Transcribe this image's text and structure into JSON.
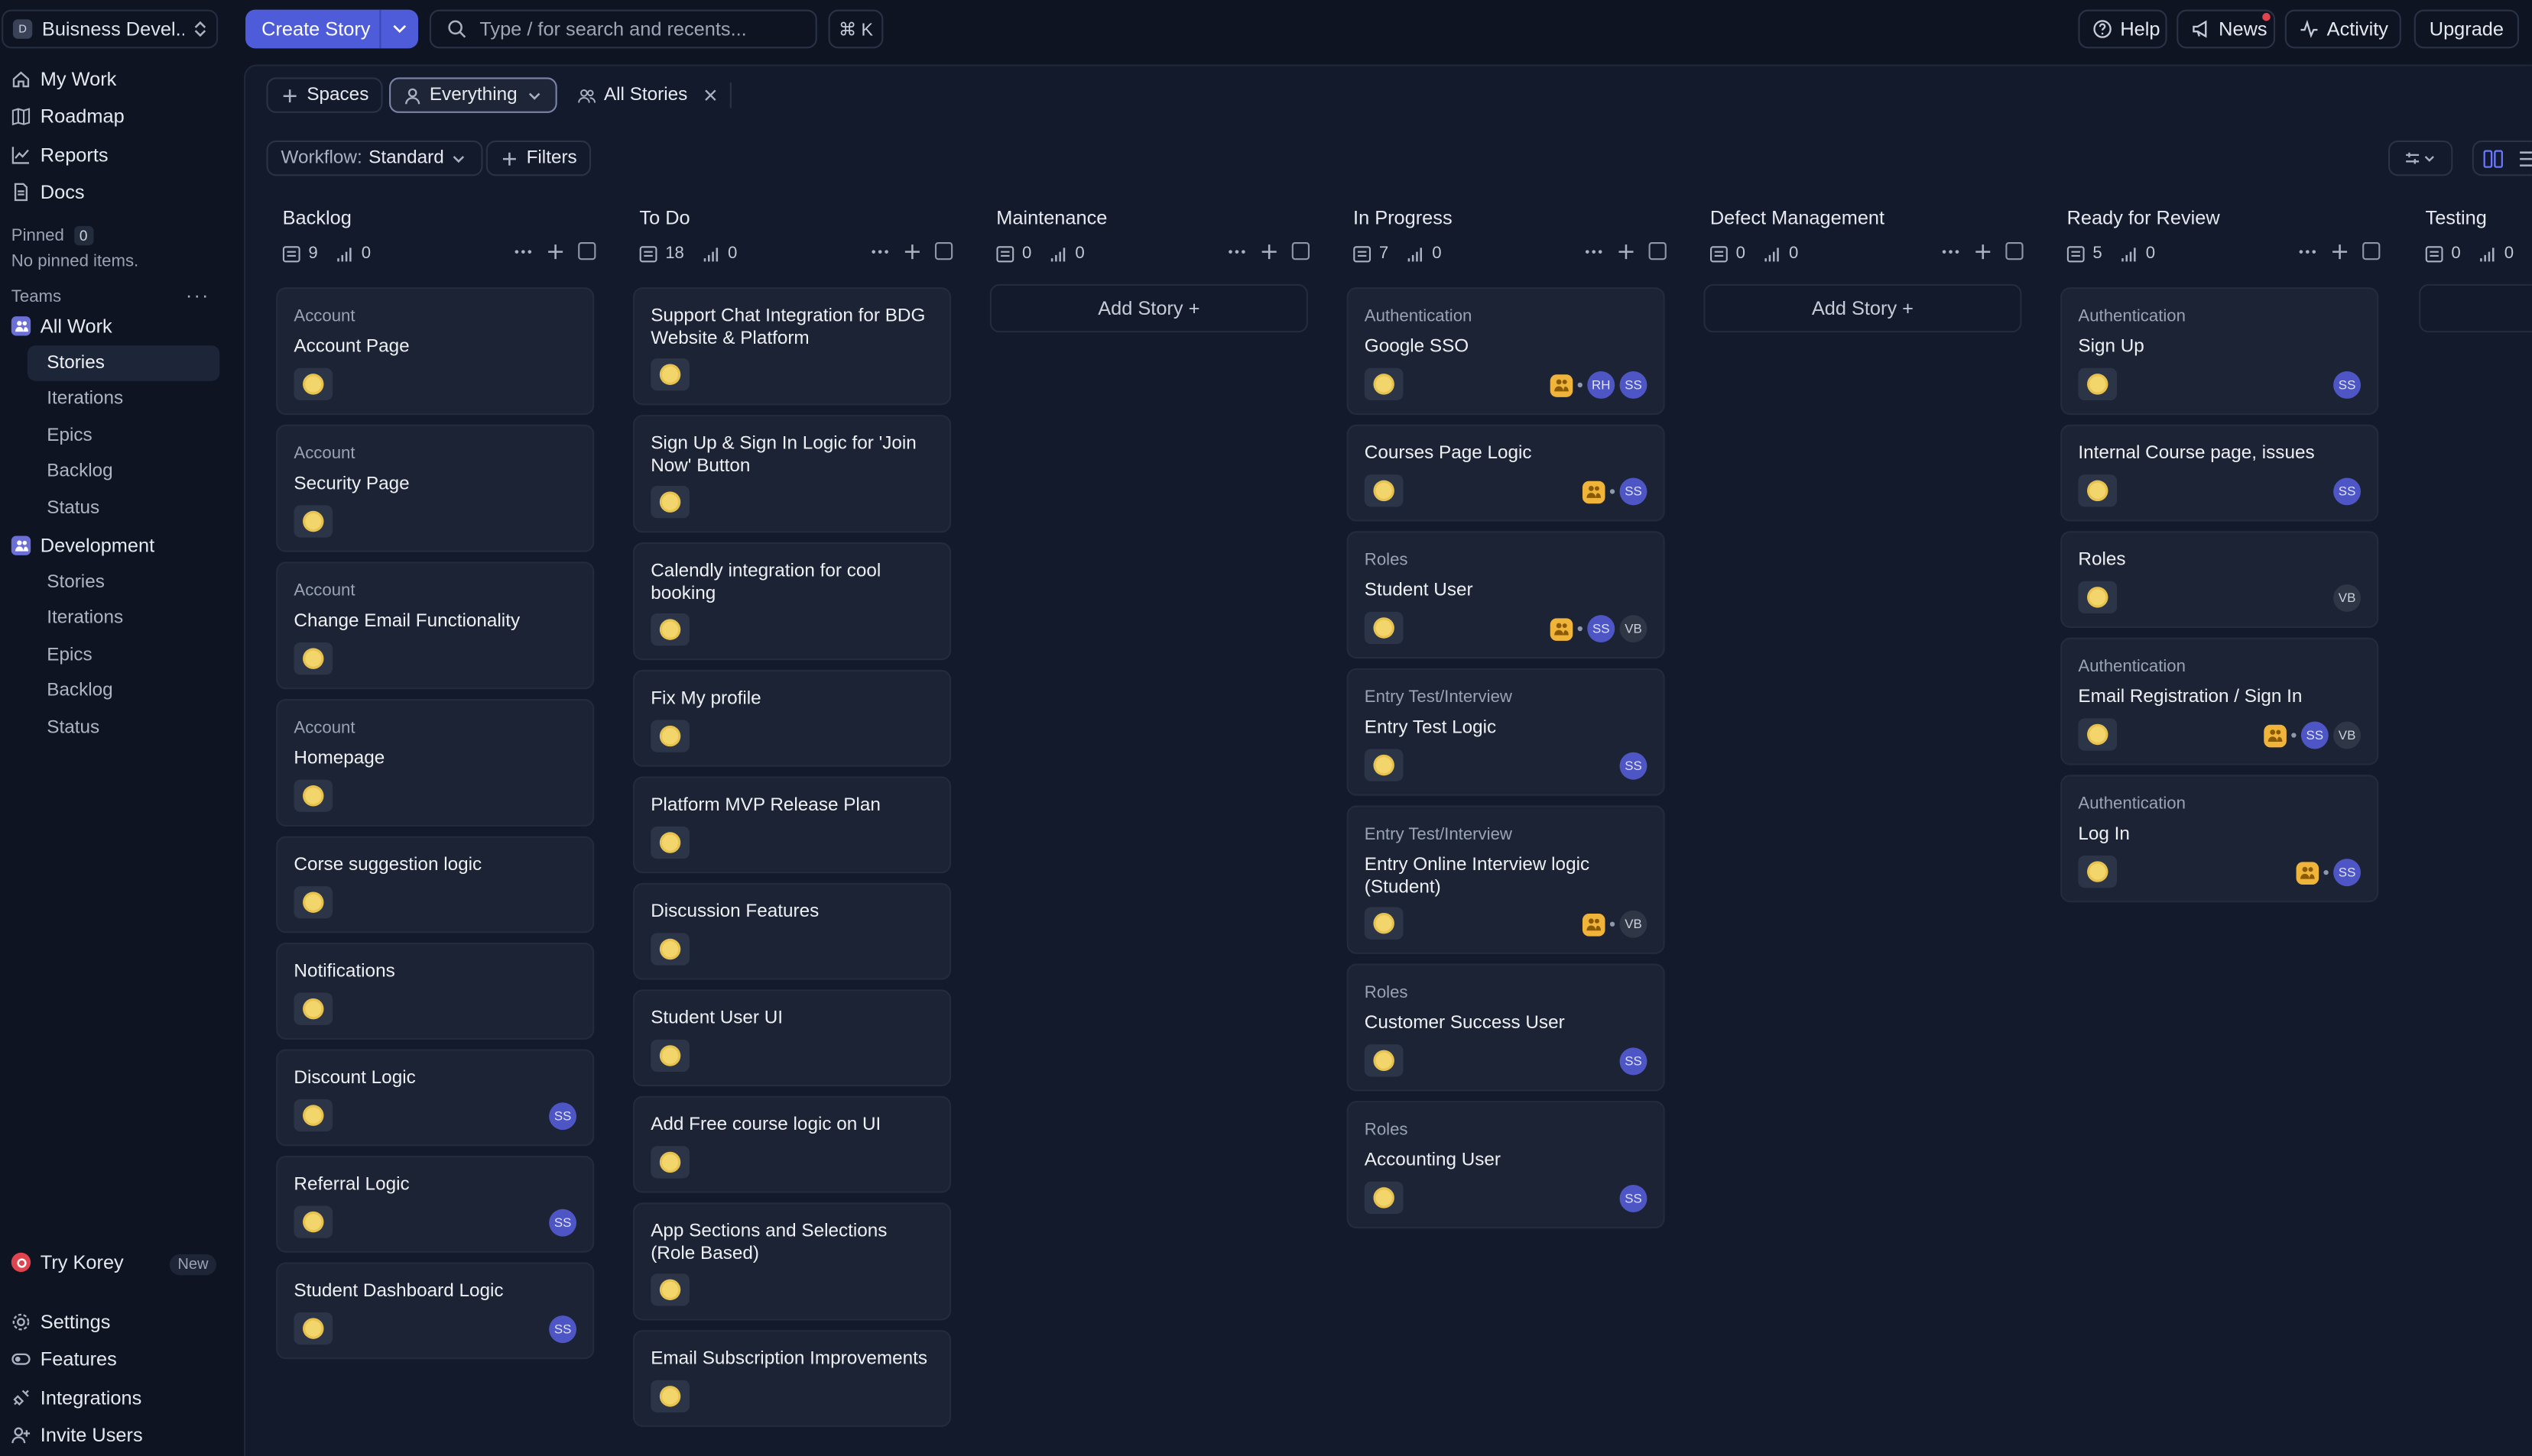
{
  "workspace": {
    "logo_letter": "D",
    "name": "Buisness Devel..."
  },
  "sidebar": {
    "nav": [
      {
        "label": "My Work",
        "icon": "home-icon"
      },
      {
        "label": "Roadmap",
        "icon": "map-icon"
      },
      {
        "label": "Reports",
        "icon": "chart-line-icon"
      },
      {
        "label": "Docs",
        "icon": "doc-icon"
      }
    ],
    "pinned": {
      "label": "Pinned",
      "count": "0",
      "empty_text": "No pinned items."
    },
    "teams_label": "Teams",
    "teams_more": "···",
    "teams": [
      {
        "label": "All Work",
        "items": [
          "Stories",
          "Iterations",
          "Epics",
          "Backlog",
          "Status"
        ],
        "active": "Stories"
      },
      {
        "label": "Development",
        "items": [
          "Stories",
          "Iterations",
          "Epics",
          "Backlog",
          "Status"
        ]
      }
    ],
    "try_korey": {
      "label": "Try Korey",
      "badge": "New"
    },
    "bottom": [
      {
        "label": "Settings",
        "icon": "gear-icon"
      },
      {
        "label": "Features",
        "icon": "toggle-icon"
      },
      {
        "label": "Integrations",
        "icon": "plug-icon"
      },
      {
        "label": "Invite Users",
        "icon": "user-plus-icon"
      }
    ]
  },
  "topbar": {
    "create_label": "Create Story",
    "search_placeholder": "Type / for search and recents...",
    "shortcut": "⌘ K",
    "help": "Help",
    "news": "News",
    "activity": "Activity",
    "upgrade": "Upgrade"
  },
  "filters": {
    "spaces": "Spaces",
    "everything": "Everything",
    "all_stories": "All Stories",
    "workflow_label": "Workflow:",
    "workflow_value": "Standard",
    "filters_label": "Filters"
  },
  "board": {
    "add_story": "Add Story +",
    "columns": [
      {
        "title": "Backlog",
        "stories": "9",
        "points": "0",
        "cards": [
          {
            "epic": "Account",
            "title": "Account Page",
            "avatars": []
          },
          {
            "epic": "Account",
            "title": "Security Page",
            "avatars": []
          },
          {
            "epic": "Account",
            "title": "Change Email Functionality",
            "avatars": []
          },
          {
            "epic": "Account",
            "title": "Homepage",
            "avatars": []
          },
          {
            "epic": "",
            "title": "Corse suggestion logic",
            "avatars": []
          },
          {
            "epic": "",
            "title": "Notifications",
            "avatars": []
          },
          {
            "epic": "",
            "title": "Discount Logic",
            "avatars": [
              "SS"
            ]
          },
          {
            "epic": "",
            "title": "Referral Logic",
            "avatars": [
              "SS"
            ]
          },
          {
            "epic": "",
            "title": "Student Dashboard Logic",
            "avatars": [
              "SS"
            ]
          }
        ]
      },
      {
        "title": "To Do",
        "stories": "18",
        "points": "0",
        "cards": [
          {
            "epic": "",
            "title": "Support Chat Integration for BDG Website & Platform",
            "avatars": []
          },
          {
            "epic": "",
            "title": "Sign Up & Sign In Logic for 'Join Now' Button",
            "avatars": []
          },
          {
            "epic": "",
            "title": "Calendly integration for cool booking",
            "avatars": []
          },
          {
            "epic": "",
            "title": "Fix My profile",
            "avatars": []
          },
          {
            "epic": "",
            "title": "Platform MVP Release Plan",
            "avatars": []
          },
          {
            "epic": "",
            "title": "Discussion Features",
            "avatars": []
          },
          {
            "epic": "",
            "title": "Student User UI",
            "avatars": []
          },
          {
            "epic": "",
            "title": "Add Free course logic on UI",
            "avatars": []
          },
          {
            "epic": "",
            "title": "App Sections and Selections (Role Based)",
            "avatars": []
          },
          {
            "epic": "",
            "title": "Email Subscription Improvements",
            "avatars": []
          }
        ]
      },
      {
        "title": "Maintenance",
        "stories": "0",
        "points": "0",
        "cards": []
      },
      {
        "title": "In Progress",
        "stories": "7",
        "points": "0",
        "cards": [
          {
            "epic": "Authentication",
            "title": "Google SSO",
            "avatars": [
              "team",
              "RH",
              "SS"
            ]
          },
          {
            "epic": "",
            "title": "Courses Page Logic",
            "avatars": [
              "team",
              "SS"
            ]
          },
          {
            "epic": "Roles",
            "title": "Student User",
            "avatars": [
              "team",
              "SS",
              "VB"
            ]
          },
          {
            "epic": "Entry Test/Interview",
            "title": "Entry Test Logic",
            "avatars": [
              "SS"
            ]
          },
          {
            "epic": "Entry Test/Interview",
            "title": "Entry Online Interview logic (Student)",
            "avatars": [
              "team",
              "VB"
            ]
          },
          {
            "epic": "Roles",
            "title": "Customer Success User",
            "avatars": [
              "SS"
            ]
          },
          {
            "epic": "Roles",
            "title": "Accounting User",
            "avatars": [
              "SS"
            ]
          }
        ]
      },
      {
        "title": "Defect Management",
        "stories": "0",
        "points": "0",
        "cards": []
      },
      {
        "title": "Ready for Review",
        "stories": "5",
        "points": "0",
        "cards": [
          {
            "epic": "Authentication",
            "title": "Sign Up",
            "avatars": [
              "SS"
            ]
          },
          {
            "epic": "",
            "title": "Internal Course page, issues",
            "avatars": [
              "SS"
            ]
          },
          {
            "epic": "",
            "title": "Roles",
            "avatars": [
              "VB"
            ]
          },
          {
            "epic": "Authentication",
            "title": "Email Registration / Sign In",
            "avatars": [
              "team",
              "SS",
              "VB"
            ]
          },
          {
            "epic": "Authentication",
            "title": "Log In",
            "avatars": [
              "team",
              "SS"
            ]
          }
        ]
      },
      {
        "title": "Testing",
        "stories": "0",
        "points": "0",
        "cards": []
      }
    ]
  },
  "colors": {
    "accent": "#4f5cd9",
    "background": "#0e1422",
    "card": "#1b2334",
    "avatar": "#4e55c5",
    "story_estimate": "#f2d56b"
  }
}
